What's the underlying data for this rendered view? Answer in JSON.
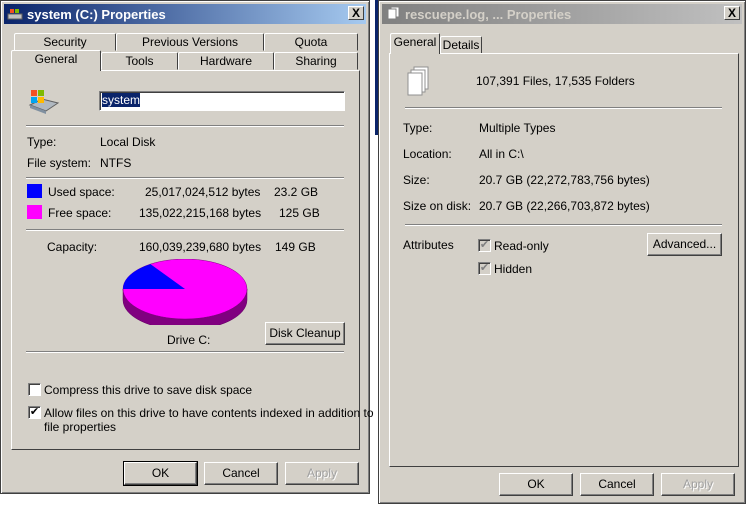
{
  "left_window": {
    "title": "system (C:) Properties",
    "close_label": "X",
    "tabs_row1": [
      "Security",
      "Previous Versions",
      "Quota"
    ],
    "tabs_row2": [
      "General",
      "Tools",
      "Hardware",
      "Sharing"
    ],
    "selected_tab": "General",
    "drive_name_value": "system",
    "type_label": "Type:",
    "type_value": "Local Disk",
    "fs_label": "File system:",
    "fs_value": "NTFS",
    "used_label": "Used space:",
    "used_bytes": "25,017,024,512 bytes",
    "used_size": "23.2 GB",
    "free_label": "Free space:",
    "free_bytes": "135,022,215,168 bytes",
    "free_size": "125 GB",
    "capacity_label": "Capacity:",
    "capacity_bytes": "160,039,239,680 bytes",
    "capacity_size": "149 GB",
    "drive_label": "Drive C:",
    "disk_cleanup_label": "Disk Cleanup",
    "compress_label": "Compress this drive to save disk space",
    "compress_checked": false,
    "index_label_line1": "Allow files on this drive to have contents indexed in addition to",
    "index_label_line2": "file properties",
    "index_checked": true,
    "ok_label": "OK",
    "cancel_label": "Cancel",
    "apply_label": "Apply",
    "colors": {
      "used": "#0000ff",
      "free": "#ff00ff",
      "free_shadow": "#800080"
    },
    "used_fraction": 0.156
  },
  "right_window": {
    "title": "rescuepe.log, ... Properties",
    "close_label": "X",
    "tabs": [
      "General",
      "Details"
    ],
    "selected_tab": "General",
    "summary": "107,391 Files, 17,535 Folders",
    "type_label": "Type:",
    "type_value": "Multiple Types",
    "location_label": "Location:",
    "location_value": "All in C:\\",
    "size_label": "Size:",
    "size_value": "20.7 GB (22,272,783,756 bytes)",
    "size_on_disk_label": "Size on disk:",
    "size_on_disk_value": "20.7 GB (22,266,703,872 bytes)",
    "attributes_label": "Attributes",
    "readonly_label": "Read-only",
    "readonly_checked": true,
    "hidden_label": "Hidden",
    "hidden_checked": true,
    "advanced_label": "Advanced...",
    "ok_label": "OK",
    "cancel_label": "Cancel",
    "apply_label": "Apply"
  }
}
